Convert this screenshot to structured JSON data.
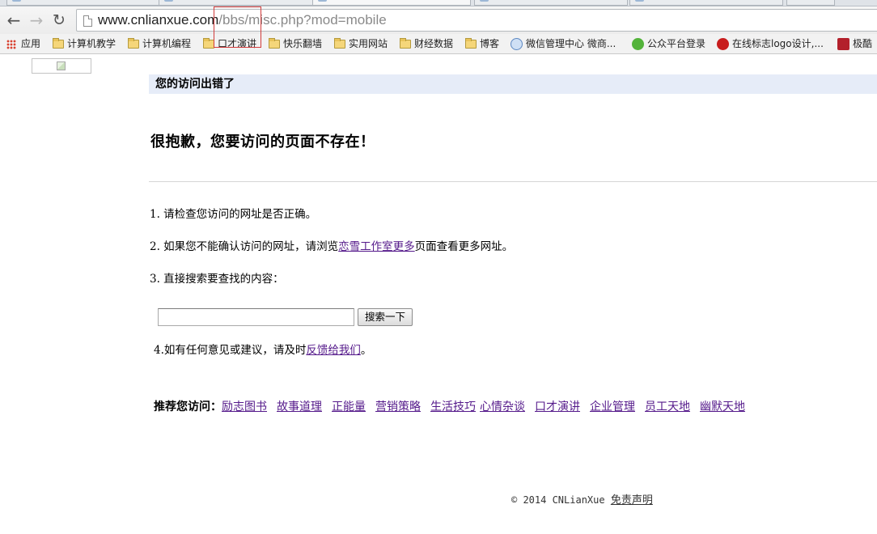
{
  "browser": {
    "tabs": [
      {
        "title": "…"
      },
      {
        "title": "…"
      },
      {
        "title": "…"
      },
      {
        "title": "…"
      },
      {
        "title": "…"
      },
      {
        "title": ""
      }
    ],
    "url_host": "www.cnlianxue.com",
    "url_path": "/bbs/misc.php?mod=mobile",
    "bookmarks": [
      {
        "label": "应用",
        "icon": "apps-icon"
      },
      {
        "label": "计算机教学",
        "icon": "folder-icon"
      },
      {
        "label": "计算机编程",
        "icon": "folder-icon"
      },
      {
        "label": "口才演讲",
        "icon": "folder-icon"
      },
      {
        "label": "快乐翻墙",
        "icon": "folder-icon"
      },
      {
        "label": "实用网站",
        "icon": "folder-icon"
      },
      {
        "label": "财经数据",
        "icon": "folder-icon"
      },
      {
        "label": "博客",
        "icon": "folder-icon"
      },
      {
        "label": "微信管理中心 微商...",
        "icon": "weixin-icon"
      },
      {
        "label": "公众平台登录",
        "icon": "wechat-icon"
      },
      {
        "label": "在线标志logo设计,...",
        "icon": "logo-design-icon"
      },
      {
        "label": "极酷",
        "icon": "jiku-icon"
      }
    ]
  },
  "page": {
    "error_header": "您的访问出错了",
    "error_title": "很抱歉，您要访问的页面不存在！",
    "tips": {
      "tip1": "1. 请检查您访问的网址是否正确。",
      "tip2_before": "2. 如果您不能确认访问的网址，请浏览",
      "tip2_link": "恋雪工作室更多",
      "tip2_after": "页面查看更多网址。",
      "tip3": "3. 直接搜索要查找的内容：",
      "tip4_before": "4.如有任何意见或建议，请及时",
      "tip4_link": "反馈给我们",
      "tip4_after": "。"
    },
    "search": {
      "value": "",
      "button_label": "搜索一下"
    },
    "recommend": {
      "label": "推荐您访问：",
      "links": [
        "励志图书",
        "故事道理",
        "正能量",
        "营销策略",
        "生活技巧",
        "心情杂谈",
        "口才演讲",
        "企业管理",
        "员工天地",
        "幽默天地"
      ]
    },
    "footer": {
      "copyright": "© 2014 CNLianXue ",
      "disclaimer": "免责声明"
    }
  }
}
